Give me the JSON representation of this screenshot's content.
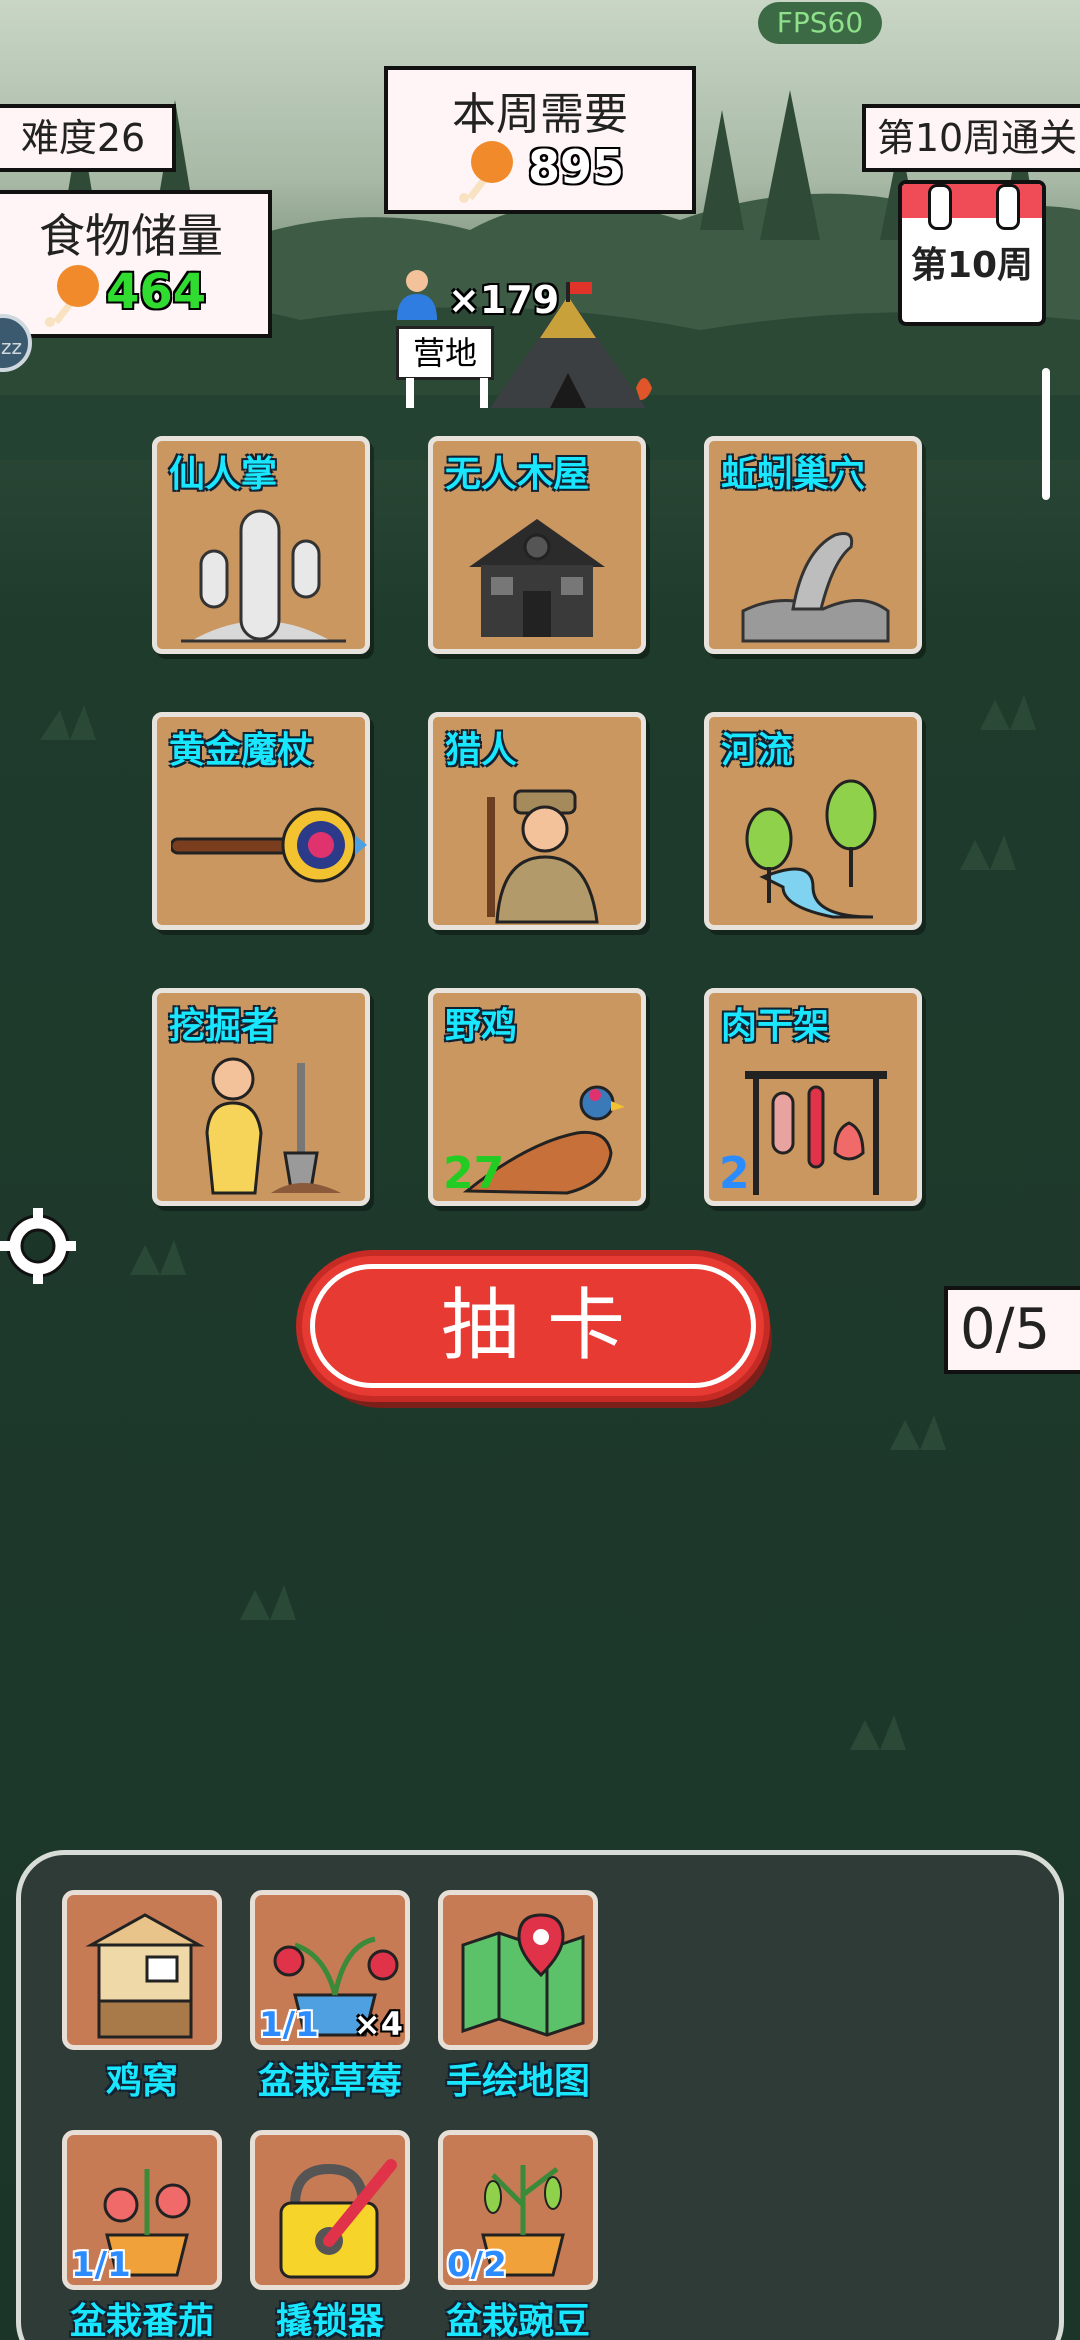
{
  "hud": {
    "fps": "FPS60",
    "difficulty": "难度26",
    "weekly_need_title": "本周需要",
    "weekly_need_value": "895",
    "clear_week": "第10周通关",
    "food_title": "食物储量",
    "food_value": "464",
    "population": "×179",
    "camp_label": "营地",
    "calendar_week": "第10周",
    "draw_counter": "0/5",
    "accent_food_value": "#2fdc2f"
  },
  "cards": [
    {
      "title": "仙人掌",
      "icon": "cactus-icon"
    },
    {
      "title": "无人木屋",
      "icon": "log-cabin-icon"
    },
    {
      "title": "蚯蚓巢穴",
      "icon": "worm-burrow-icon"
    },
    {
      "title": "黄金魔杖",
      "icon": "golden-wand-icon"
    },
    {
      "title": "猎人",
      "icon": "hunter-icon"
    },
    {
      "title": "河流",
      "icon": "river-icon"
    },
    {
      "title": "挖掘者",
      "icon": "digger-icon"
    },
    {
      "title": "野鸡",
      "icon": "pheasant-icon",
      "count": "27",
      "count_color": "#22cc22"
    },
    {
      "title": "肉干架",
      "icon": "jerky-rack-icon",
      "count": "2",
      "count_color": "#2a8cff"
    }
  ],
  "draw_button": "抽卡",
  "inventory": [
    {
      "name": "鸡窝",
      "icon": "chicken-coop-icon"
    },
    {
      "name": "盆栽草莓",
      "icon": "potted-strawberry-icon",
      "qty": "1/1",
      "multiplier": "×4"
    },
    {
      "name": "手绘地图",
      "icon": "hand-drawn-map-icon"
    },
    {
      "name": "盆栽番茄",
      "icon": "potted-tomato-icon",
      "qty": "1/1"
    },
    {
      "name": "撬锁器",
      "icon": "lockpick-icon"
    },
    {
      "name": "盆栽豌豆",
      "icon": "potted-pea-icon",
      "qty": "0/2"
    }
  ],
  "side": {
    "sleep_badge": "zz",
    "settings_icon": "gear-icon"
  }
}
